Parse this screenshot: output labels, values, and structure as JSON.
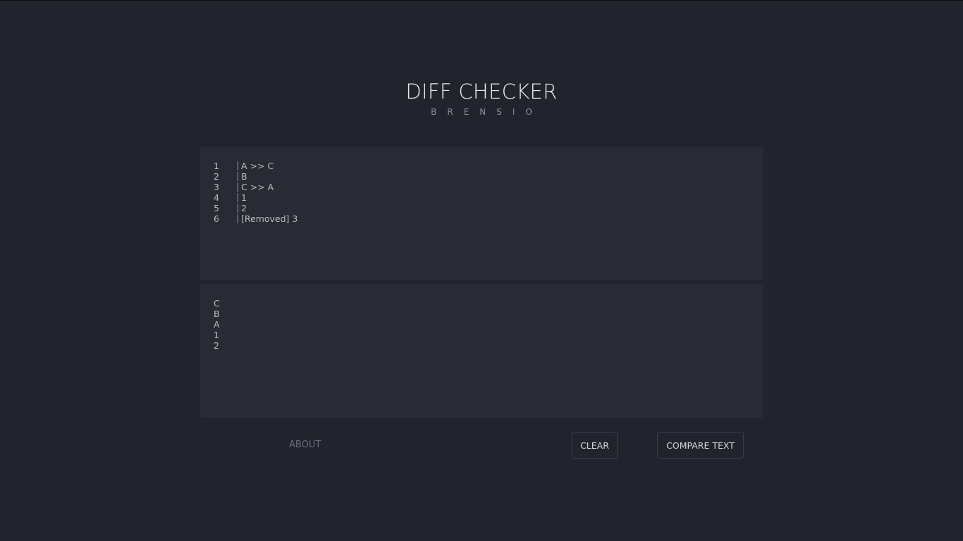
{
  "header": {
    "title": "DIFF CHECKER",
    "subtitle": "BRENSIO"
  },
  "result": {
    "lines": [
      {
        "num": "1",
        "text": "A >> C"
      },
      {
        "num": "2",
        "text": "B"
      },
      {
        "num": "3",
        "text": "C >> A"
      },
      {
        "num": "4",
        "text": "1"
      },
      {
        "num": "5",
        "text": "2"
      },
      {
        "num": "6",
        "text": "[Removed] 3"
      }
    ]
  },
  "input": {
    "lines": [
      "C",
      "B",
      "A",
      "1",
      "2"
    ]
  },
  "footer": {
    "about_label": "ABOUT",
    "clear_label": "CLEAR",
    "compare_label": "COMPARE TEXT"
  }
}
